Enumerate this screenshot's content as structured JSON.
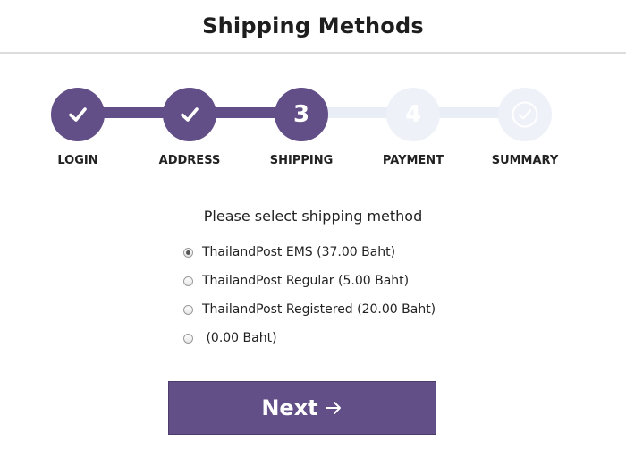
{
  "page": {
    "title": "Shipping Methods"
  },
  "colors": {
    "accent": "#624f87",
    "pending": "#eef1f7"
  },
  "stepper": {
    "current_step": 3,
    "steps": [
      {
        "label": "LOGIN",
        "state": "done",
        "icon": "check-icon"
      },
      {
        "label": "ADDRESS",
        "state": "done",
        "icon": "check-icon"
      },
      {
        "label": "SHIPPING",
        "state": "current",
        "number": "3"
      },
      {
        "label": "PAYMENT",
        "state": "todo",
        "number": "4"
      },
      {
        "label": "SUMMARY",
        "state": "todo",
        "icon": "check-icon"
      }
    ]
  },
  "shipping": {
    "prompt": "Please select shipping method",
    "options": [
      {
        "label": "ThailandPost EMS (37.00 Baht)",
        "checked": true
      },
      {
        "label": "ThailandPost Regular (5.00 Baht)",
        "checked": false
      },
      {
        "label": "ThailandPost Registered (20.00 Baht)",
        "checked": false
      },
      {
        "label": " (0.00 Baht)",
        "checked": false
      }
    ]
  },
  "actions": {
    "next_label": "Next",
    "next_icon": "arrow-right-icon"
  }
}
